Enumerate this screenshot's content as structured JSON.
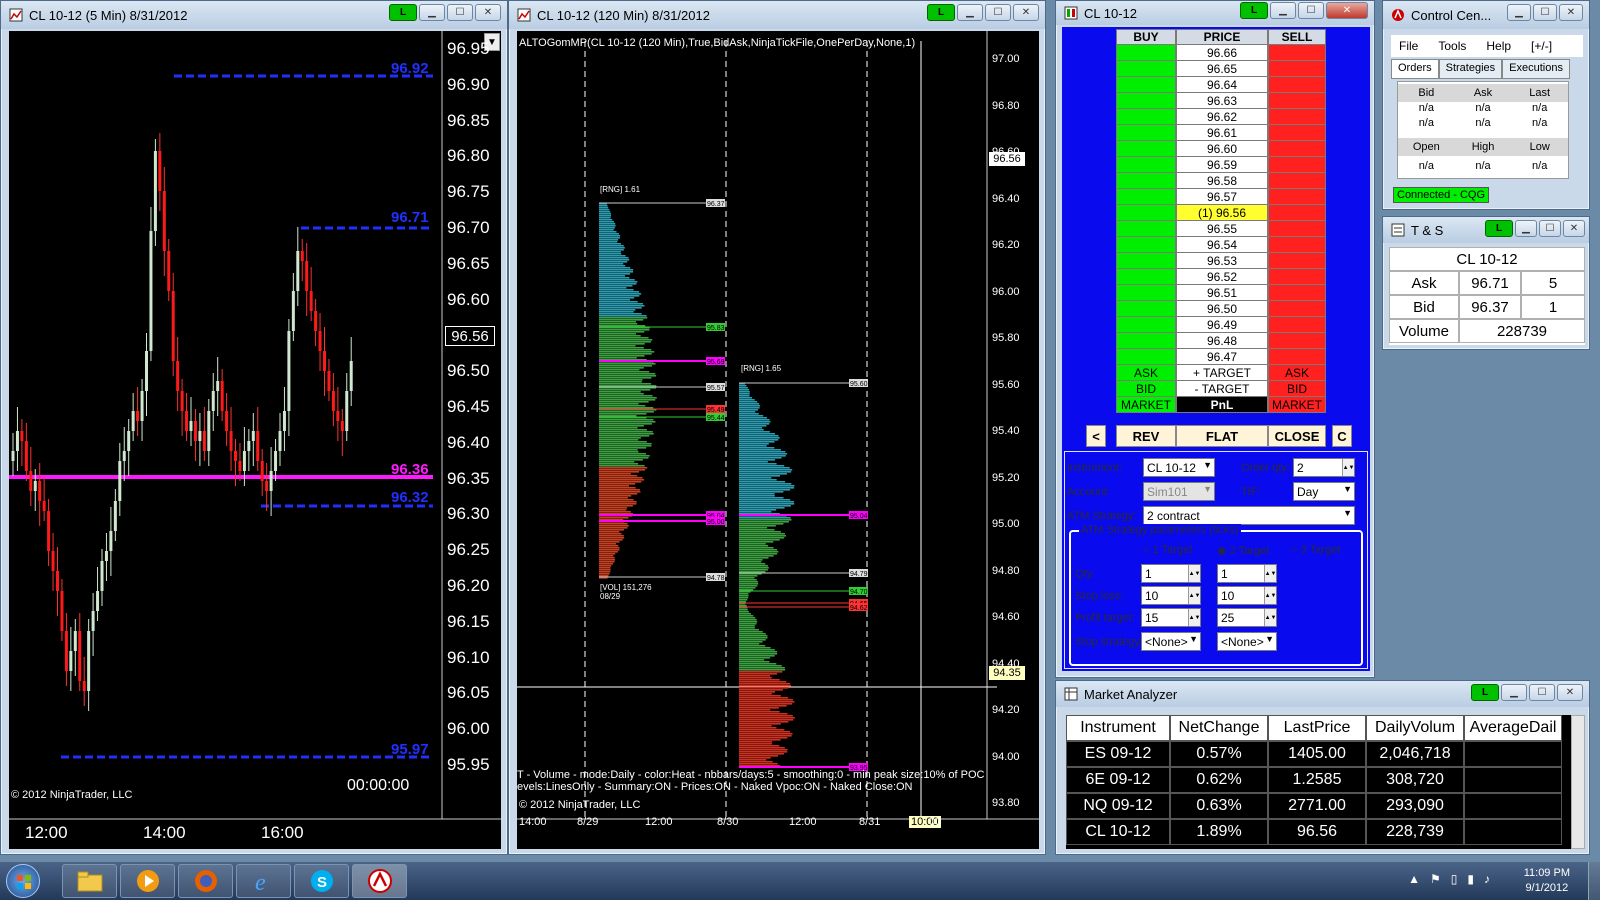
{
  "chart5": {
    "title": "CL 10-12 (5 Min)  8/31/2012",
    "link_label": "L",
    "prices": [
      "96.95",
      "96.90",
      "96.85",
      "96.80",
      "96.75",
      "96.70",
      "96.65",
      "96.60",
      "96.55",
      "96.50",
      "96.45",
      "96.40",
      "96.35",
      "96.30",
      "96.25",
      "96.20",
      "96.15",
      "96.10",
      "96.05",
      "96.00",
      "95.95"
    ],
    "times": [
      "12:00",
      "14:00",
      "16:00"
    ],
    "level_high": "96.92",
    "level_mid": "96.71",
    "level_poc": "96.36",
    "level_low1": "96.32",
    "level_low2": "95.97",
    "last_price": "96.56",
    "timer": "00:00:00",
    "copyright": "© 2012 NinjaTrader, LLC"
  },
  "chart120": {
    "title": "CL 10-12 (120 Min)  8/31/2012",
    "link_label": "L",
    "indicator": "ALTOGomMP(CL 10-12 (120 Min),True,BidAsk,NinjaTickFile,OnePerDay,None,1)",
    "prices": [
      "97.00",
      "96.80",
      "96.60",
      "96.40",
      "96.20",
      "96.00",
      "95.80",
      "95.60",
      "95.40",
      "95.20",
      "95.00",
      "94.80",
      "94.60",
      "94.40",
      "94.20",
      "94.00",
      "93.80"
    ],
    "times": [
      "14:00",
      "8/29",
      "12:00",
      "8/30",
      "12:00",
      "8/31",
      "10:00",
      "00"
    ],
    "rng1": "[RNG] 1.61",
    "rng2": "[RNG] 1.65",
    "vol1": "[VOL] 151,276",
    "vol1_date": "08/29",
    "last_price": "96.56",
    "cross_price": "94.35",
    "summary1": "T - Volume - mode:Daily - color:Heat - nbbars/days:5 - smoothing:0 - min peak size:10% of POC",
    "summary2": "evels:LinesOnly - Summary:ON - Prices:ON - Naked Vpoc:ON - Naked Close:ON",
    "copyright": "© 2012 NinjaTrader, LLC",
    "tags1": [
      "96.37",
      "95.83",
      "95.69",
      "95.57",
      "95.49",
      "95.44",
      "95.04",
      "95.00",
      "94.78"
    ],
    "tags2": [
      "95.60",
      "95.04",
      "94.79",
      "94.70",
      "94.65",
      "94.62",
      "93.95"
    ]
  },
  "dom": {
    "title": "CL 10-12",
    "link_label": "L",
    "headers": {
      "buy": "BUY",
      "price": "PRICE",
      "sell": "SELL"
    },
    "prices": [
      "96.66",
      "96.65",
      "96.64",
      "96.63",
      "96.62",
      "96.61",
      "96.60",
      "96.59",
      "96.58",
      "96.57",
      "(1) 96.56",
      "96.55",
      "96.54",
      "96.53",
      "96.52",
      "96.51",
      "96.50",
      "96.49",
      "96.48",
      "96.47"
    ],
    "ask_row": {
      "buy": "ASK",
      "price": "+ TARGET",
      "sell": "ASK"
    },
    "bid_row": {
      "buy": "BID",
      "price": "- TARGET",
      "sell": "BID"
    },
    "market_row": {
      "buy": "MARKET",
      "price": "PnL",
      "sell": "MARKET"
    },
    "buttons": {
      "left": "<",
      "rev": "REV",
      "flat": "FLAT",
      "close": "CLOSE",
      "c": "C"
    },
    "form": {
      "instrument_label": "Instrument:",
      "instrument": "CL 10-12",
      "order_qty_label": "Order qty:",
      "order_qty": "2",
      "account_label": "Account:",
      "account": "Sim101",
      "tif_label": "TIF:",
      "tif": "Day",
      "atm_label": "ATM Strategy:",
      "atm": "2 contract",
      "params_label": "ATM Strategy parameters (ticks)",
      "t1": "1 Target",
      "t2": "2 Target",
      "t3": "3 Target",
      "qty_label": "Qty:",
      "qty1": "1",
      "qty2": "1",
      "stop_label": "Stop loss:",
      "stop1": "10",
      "stop2": "10",
      "profit_label": "Profit target:",
      "profit1": "15",
      "profit2": "25",
      "stopstrat_label": "Stop strategy:",
      "ss1": "<None>",
      "ss2": "<None>"
    }
  },
  "control": {
    "title": "Control Cen...",
    "menu": [
      "File",
      "Tools",
      "Help",
      "[+/-]"
    ],
    "tabs": [
      "Orders",
      "Strategies",
      "Executions"
    ],
    "grid_head1": [
      "Bid",
      "Ask",
      "Last"
    ],
    "grid_row1": [
      "n/a",
      "n/a",
      "n/a"
    ],
    "grid_row2": [
      "n/a",
      "n/a",
      "n/a"
    ],
    "grid_head2": [
      "Open",
      "High",
      "Low"
    ],
    "grid_row3": [
      "n/a",
      "n/a",
      "n/a"
    ],
    "status": "Connected - CQG"
  },
  "ts": {
    "title": "T & S",
    "link_label": "L",
    "instrument": "CL 10-12",
    "ask_label": "Ask",
    "ask_price": "96.71",
    "ask_size": "5",
    "bid_label": "Bid",
    "bid_price": "96.37",
    "bid_size": "1",
    "volume_label": "Volume",
    "volume": "228739"
  },
  "market_analyzer": {
    "title": "Market Analyzer",
    "link_label": "L",
    "columns": [
      "Instrument",
      "NetChange",
      "LastPrice",
      "DailyVolum",
      "AverageDail"
    ],
    "rows": [
      [
        "ES 09-12",
        "0.57%",
        "1405.00",
        "2,046,718",
        ""
      ],
      [
        "6E 09-12",
        "0.62%",
        "1.2585",
        "308,720",
        ""
      ],
      [
        "NQ 09-12",
        "0.63%",
        "2771.00",
        "293,090",
        ""
      ],
      [
        "CL 10-12",
        "1.89%",
        "96.56",
        "228,739",
        ""
      ]
    ]
  },
  "taskbar": {
    "time": "11:09 PM",
    "date": "9/1/2012"
  }
}
